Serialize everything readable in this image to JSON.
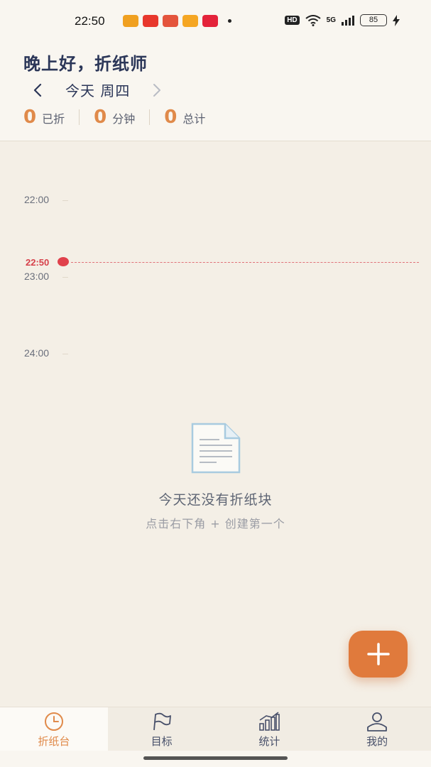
{
  "status_bar": {
    "time": "22:50",
    "hd": "HD",
    "network": "5G",
    "battery": "85",
    "app_icon_colors": [
      "#f0a020",
      "#e8372c",
      "#e4543c",
      "#f5a623",
      "#e4233a"
    ]
  },
  "header": {
    "greeting": "晚上好，折纸师",
    "date_label": "今天 周四",
    "prev_icon": "chevron-left-icon",
    "next_icon": "chevron-right-icon",
    "stats": [
      {
        "value": "0",
        "label": "已折"
      },
      {
        "value": "0",
        "label": "分钟"
      },
      {
        "value": "0",
        "label": "总计"
      }
    ]
  },
  "timeline": {
    "hours": [
      "22:00",
      "23:00",
      "24:00"
    ],
    "now_label": "22:50"
  },
  "empty_state": {
    "icon": "document-icon",
    "title": "今天还没有折纸块",
    "subtitle": "点击右下角 + 创建第一个"
  },
  "fab": {
    "icon": "plus-icon"
  },
  "bottom_nav": [
    {
      "label": "折纸台",
      "icon": "clock-icon",
      "active": true
    },
    {
      "label": "目标",
      "icon": "flag-icon",
      "active": false
    },
    {
      "label": "统计",
      "icon": "chart-icon",
      "active": false
    },
    {
      "label": "我的",
      "icon": "user-icon",
      "active": false
    }
  ],
  "colors": {
    "accent": "#e07a3c",
    "now_red": "#e0414c",
    "title_navy": "#2b3658",
    "background": "#f4efe6"
  }
}
